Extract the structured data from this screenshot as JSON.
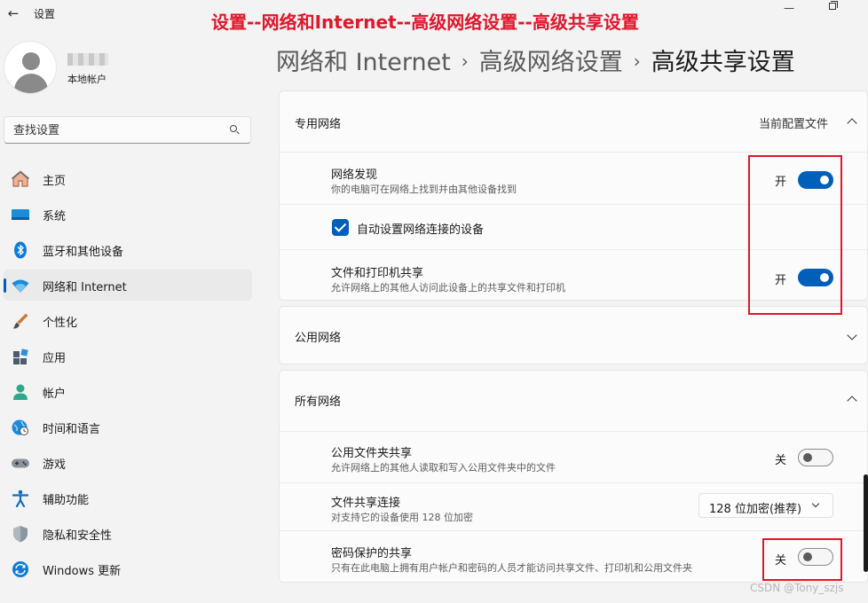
{
  "window": {
    "app_title": "设置",
    "annotation": "设置--网络和Internet--高级网络设置--高级共享设置"
  },
  "user": {
    "account_type": "本地帐户"
  },
  "search": {
    "placeholder": "查找设置"
  },
  "sidebar": {
    "items": [
      {
        "label": "主页",
        "icon": "home-icon"
      },
      {
        "label": "系统",
        "icon": "monitor-icon"
      },
      {
        "label": "蓝牙和其他设备",
        "icon": "bluetooth-icon"
      },
      {
        "label": "网络和 Internet",
        "icon": "wifi-icon",
        "active": true
      },
      {
        "label": "个性化",
        "icon": "brush-icon"
      },
      {
        "label": "应用",
        "icon": "apps-icon"
      },
      {
        "label": "帐户",
        "icon": "person-icon"
      },
      {
        "label": "时间和语言",
        "icon": "globe-clock-icon"
      },
      {
        "label": "游戏",
        "icon": "gamepad-icon"
      },
      {
        "label": "辅助功能",
        "icon": "accessibility-icon"
      },
      {
        "label": "隐私和安全性",
        "icon": "shield-icon"
      },
      {
        "label": "Windows 更新",
        "icon": "update-icon"
      }
    ]
  },
  "breadcrumb": {
    "items": [
      "网络和 Internet",
      "高级网络设置"
    ],
    "current": "高级共享设置"
  },
  "private_network": {
    "title": "专用网络",
    "badge": "当前配置文件",
    "discovery": {
      "title": "网络发现",
      "desc": "你的电脑可在网络上找到并由其他设备找到",
      "state_label": "开",
      "on": true
    },
    "auto_setup": {
      "label": "自动设置网络连接的设备",
      "checked": true
    },
    "file_printer": {
      "title": "文件和打印机共享",
      "desc": "允许网络上的其他人访问此设备上的共享文件和打印机",
      "state_label": "开",
      "on": true
    }
  },
  "public_network": {
    "title": "公用网络"
  },
  "all_networks": {
    "title": "所有网络",
    "public_folder": {
      "title": "公用文件夹共享",
      "desc": "允许网络上的其他人读取和写入公用文件夹中的文件",
      "state_label": "关",
      "on": false
    },
    "file_sharing_conn": {
      "title": "文件共享连接",
      "desc": "对支持它的设备使用 128 位加密",
      "selected": "128 位加密(推荐)"
    },
    "password_sharing": {
      "title": "密码保护的共享",
      "desc": "只有在此电脑上拥有用户帐户和密码的人员才能访问共享文件、打印机和公用文件夹",
      "state_label": "关",
      "on": false
    }
  },
  "watermark": "CSDN @Tony_szjs",
  "colors": {
    "accent": "#005fb8",
    "annotation_red": "#e0162b"
  }
}
